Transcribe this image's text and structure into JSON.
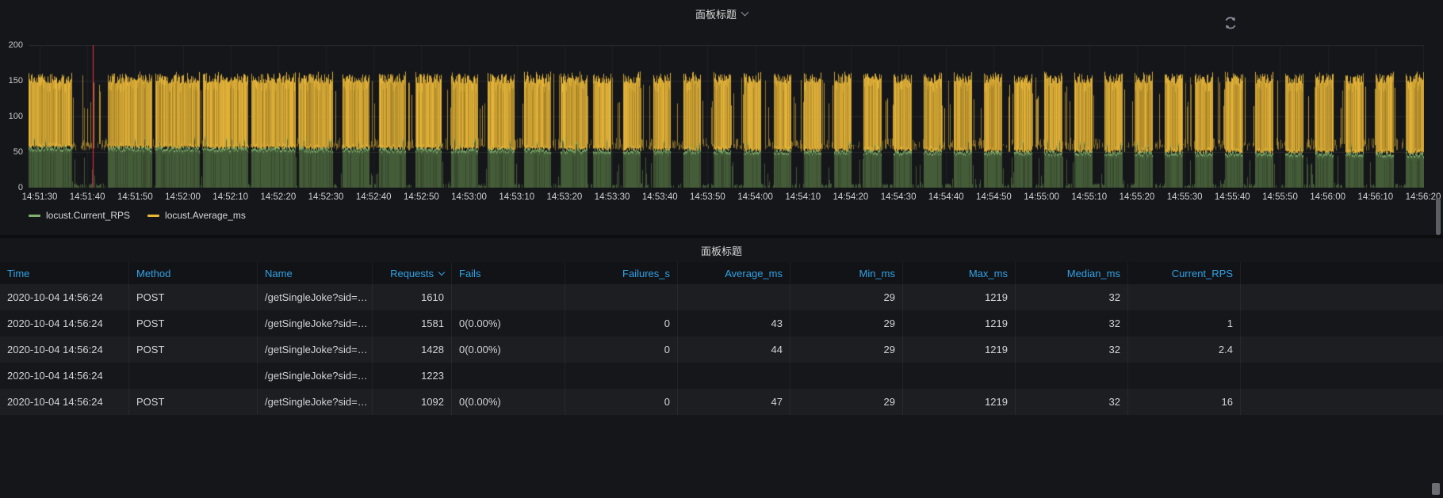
{
  "colors": {
    "page_bg": "#0c0d0f",
    "panel_bg": "#141619",
    "text": "#d8d9da",
    "axis_text": "#c8c9ca",
    "table_header_blue": "#33a2e5",
    "green": "#7EB26D",
    "green_fill": "#4a633c",
    "yellow": "#EAB839",
    "annotation_red": "#e02f44"
  },
  "icons": {
    "refresh": "circular-arrows",
    "panel_title_caret": "chevron-down",
    "requests_sort_caret": "chevron-down"
  },
  "graph_panel": {
    "title": "面板标题",
    "legend": [
      {
        "label": "locust.Current_RPS",
        "color": "#7EB26D"
      },
      {
        "label": "locust.Average_ms",
        "color": "#EAB839"
      }
    ]
  },
  "chart_data": {
    "type": "area",
    "title": "面板标题",
    "ylim": [
      0,
      200
    ],
    "yticks": [
      0,
      50,
      100,
      150,
      200
    ],
    "x_tick_labels": [
      "14:51:30",
      "14:51:40",
      "14:51:50",
      "14:52:00",
      "14:52:10",
      "14:52:20",
      "14:52:30",
      "14:52:40",
      "14:52:50",
      "14:53:00",
      "14:53:10",
      "14:53:20",
      "14:53:30",
      "14:53:40",
      "14:53:50",
      "14:54:00",
      "14:54:10",
      "14:54:20",
      "14:54:30",
      "14:54:40",
      "14:54:50",
      "14:55:00",
      "14:55:10",
      "14:55:20",
      "14:55:30",
      "14:55:40",
      "14:55:50",
      "14:56:00",
      "14:56:10",
      "14:56:20"
    ],
    "time_span_s": 292,
    "grid": true,
    "legend_position": "bottom-left",
    "series": [
      {
        "name": "locust.Current_RPS",
        "color": "#7EB26D",
        "style": "filled-area",
        "level_start": 56,
        "level_end": 47,
        "drops_to_zero_between_bursts": true
      },
      {
        "name": "locust.Average_ms",
        "color": "#EAB839",
        "style": "dense-band",
        "band_low_start": 57,
        "band_low_end": 49,
        "band_high_min": 146,
        "band_high_max": 163
      }
    ],
    "annotation_vline": {
      "x_frac": 0.046,
      "color": "#e02f44"
    },
    "burst_pattern": [
      {
        "t0": 0,
        "t1": 9,
        "mode": "solid"
      },
      {
        "t0": 9,
        "t1": 16.5,
        "mode": "sparse"
      },
      {
        "t0": 16.5,
        "t1": 58,
        "mode": "burst",
        "period": 10,
        "duty": 0.93
      },
      {
        "t0": 58,
        "t1": 118,
        "mode": "burst",
        "period": 7.6,
        "duty": 0.74
      },
      {
        "t0": 118,
        "t1": 292,
        "mode": "burst",
        "period": 6.3,
        "duty": 0.6
      }
    ],
    "seed": 11
  },
  "table_panel": {
    "title": "面板标题",
    "columns": [
      {
        "label": "Time",
        "align": "left"
      },
      {
        "label": "Method",
        "align": "left"
      },
      {
        "label": "Name",
        "align": "left"
      },
      {
        "label": "Requests",
        "align": "right",
        "sorted": true
      },
      {
        "label": "Fails",
        "align": "left"
      },
      {
        "label": "Failures_s",
        "align": "right"
      },
      {
        "label": "Average_ms",
        "align": "right"
      },
      {
        "label": "Min_ms",
        "align": "right"
      },
      {
        "label": "Max_ms",
        "align": "right"
      },
      {
        "label": "Median_ms",
        "align": "right"
      },
      {
        "label": "Current_RPS",
        "align": "right"
      }
    ],
    "rows": [
      [
        "2020-10-04 14:56:24",
        "POST",
        "/getSingleJoke?sid=…",
        "1610",
        "",
        "",
        "",
        "29",
        "1219",
        "32",
        ""
      ],
      [
        "2020-10-04 14:56:24",
        "POST",
        "/getSingleJoke?sid=…",
        "1581",
        "0(0.00%)",
        "0",
        "43",
        "29",
        "1219",
        "32",
        "1"
      ],
      [
        "2020-10-04 14:56:24",
        "POST",
        "/getSingleJoke?sid=…",
        "1428",
        "0(0.00%)",
        "0",
        "44",
        "29",
        "1219",
        "32",
        "2.4"
      ],
      [
        "2020-10-04 14:56:24",
        "",
        "/getSingleJoke?sid=…",
        "1223",
        "",
        "",
        "",
        "",
        "",
        "",
        ""
      ],
      [
        "2020-10-04 14:56:24",
        "POST",
        "/getSingleJoke?sid=…",
        "1092",
        "0(0.00%)",
        "0",
        "47",
        "29",
        "1219",
        "32",
        "16"
      ]
    ]
  }
}
